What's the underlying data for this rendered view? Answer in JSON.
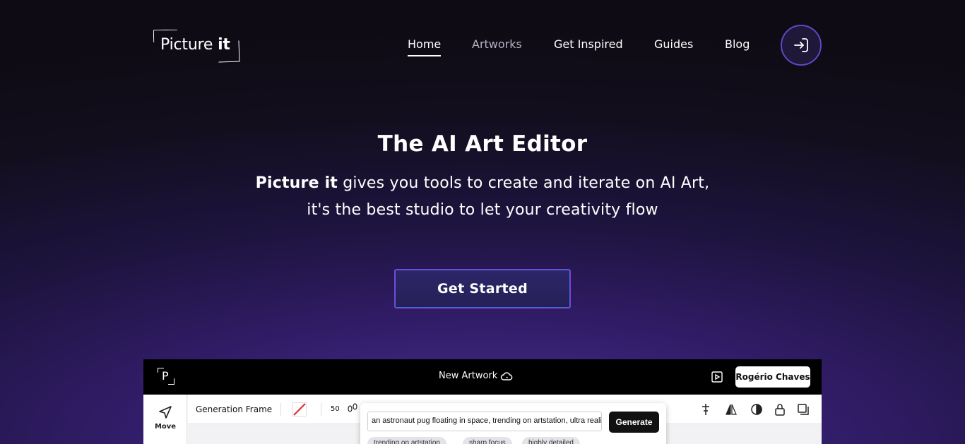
{
  "logo": {
    "text_regular": "Picture ",
    "text_bold": "it"
  },
  "nav": {
    "items": [
      {
        "label": "Home",
        "active": true
      },
      {
        "label": "Artworks",
        "active": false
      },
      {
        "label": "Get Inspired",
        "active": false
      },
      {
        "label": "Guides",
        "active": false
      },
      {
        "label": "Blog",
        "active": false
      }
    ],
    "login_icon": "login-arrow-icon"
  },
  "hero": {
    "title": "The AI Art Editor",
    "subtitle_bold": "Picture it",
    "subtitle_rest": " gives you tools to create and iterate on AI Art,",
    "subtitle_line2": "it's the best studio to let your creativity flow",
    "cta_label": "Get Started"
  },
  "editor": {
    "artwork_title": "New Artwork",
    "user_label": "Rogério Chaves",
    "move_label": "Move",
    "frame_label": "Generation Frame",
    "steps_value": "50",
    "prompt_value": "an astronaut pug floating in space, trending on artstation, ultra realistic",
    "generate_label": "Generate",
    "chips": [
      "trending on artstation",
      "sharp focus",
      "highly detailed"
    ]
  },
  "colors": {
    "accent_border": "#5e48c6",
    "cta_border": "#8a3be0"
  }
}
